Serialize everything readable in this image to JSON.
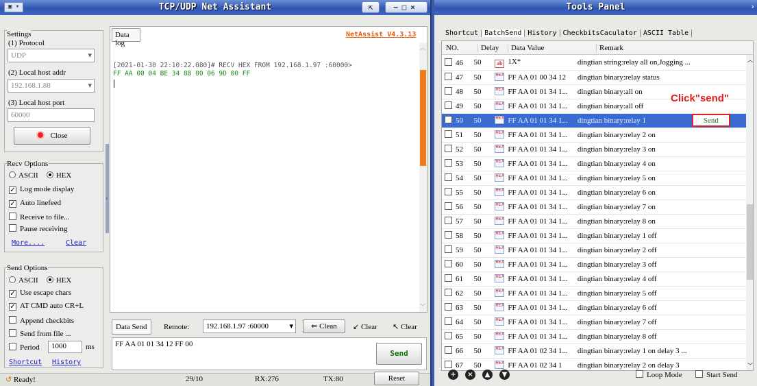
{
  "left_window": {
    "title": "TCP/UDP Net Assistant",
    "menu_icon": "app-menu-icon",
    "pin_icon": "pin-icon",
    "min_icon": "minimize-icon",
    "max_icon": "maximize-icon",
    "close_icon": "close-icon"
  },
  "settings": {
    "group_label": "Settings",
    "protocol_label": "(1) Protocol",
    "protocol_value": "UDP",
    "host_addr_label": "(2) Local host addr",
    "host_addr_value": "192.168.1.88",
    "port_label": "(3) Local host port",
    "port_value": "60000",
    "close_button": "Close"
  },
  "recv_options": {
    "label": "Recv Options",
    "ascii": "ASCII",
    "hex": "HEX",
    "log_mode": "Log mode display",
    "auto_linefeed": "Auto linefeed",
    "receive_file": "Receive to file...",
    "pause": "Pause receiving",
    "more_link": "More....",
    "clear_link": "Clear"
  },
  "send_options": {
    "label": "Send Options",
    "ascii": "ASCII",
    "hex": "HEX",
    "escape": "Use escape chars",
    "at_cmd": "AT CMD auto CR+L",
    "append_check": "Append checkbits",
    "send_file": "Send from file ...",
    "period": "Period",
    "period_value": "1000",
    "period_unit": "ms",
    "shortcut_link": "Shortcut",
    "history_link": "History"
  },
  "data_log": {
    "tab": "Data log",
    "version": "NetAssist V4.3.13",
    "line1": "[2021-01-30 22:10:22.080]# RECV HEX FROM 192.168.1.97 :60000>",
    "line2": "FF AA 00 04 BE 34 88 00 06 9D 00 FF"
  },
  "data_send": {
    "tab": "Data Send",
    "remote_label": "Remote:",
    "remote_value": "192.168.1.97 :60000",
    "clean_btn": "Clean",
    "clear_btn1": "Clear",
    "clear_btn2": "Clear",
    "text": "FF AA 01 01 34 12 FF 00",
    "send_button": "Send"
  },
  "status": {
    "ready": "Ready!",
    "ratio": "29/10",
    "rx": "RX:276",
    "tx": "TX:80",
    "reset": "Reset"
  },
  "tools": {
    "title": "Tools Panel",
    "tabs": [
      "Shortcut",
      "BatchSend",
      "History",
      "CheckbitsCaculator",
      "ASCII Table"
    ],
    "columns": [
      "NO.",
      "Delay",
      "Data Value",
      "Remark"
    ],
    "rows": [
      {
        "no": "46",
        "delay": "50",
        "type": "ab",
        "value": "1X*",
        "remark": "dingtian string:relay all on,Jogging ..."
      },
      {
        "no": "47",
        "delay": "50",
        "type": "hex",
        "value": "FF AA 01 00 34 12",
        "remark": "dingtian binary:relay status"
      },
      {
        "no": "48",
        "delay": "50",
        "type": "hex",
        "value": "FF AA 01 01 34 1...",
        "remark": "dingtian binary:all on"
      },
      {
        "no": "49",
        "delay": "50",
        "type": "hex",
        "value": "FF AA 01 01 34 1...",
        "remark": "dingtian binary:all off"
      },
      {
        "no": "50",
        "delay": "50",
        "type": "hex",
        "value": "FF AA 01 01 34 1...",
        "remark": "dingtian binary:relay 1",
        "selected": true
      },
      {
        "no": "51",
        "delay": "50",
        "type": "hex",
        "value": "FF AA 01 01 34 1...",
        "remark": "dingtian binary:relay 2 on"
      },
      {
        "no": "52",
        "delay": "50",
        "type": "hex",
        "value": "FF AA 01 01 34 1...",
        "remark": "dingtian binary:relay 3 on"
      },
      {
        "no": "53",
        "delay": "50",
        "type": "hex",
        "value": "FF AA 01 01 34 1...",
        "remark": "dingtian binary:relay 4 on"
      },
      {
        "no": "54",
        "delay": "50",
        "type": "hex",
        "value": "FF AA 01 01 34 1...",
        "remark": "dingtian binary:relay 5 on"
      },
      {
        "no": "55",
        "delay": "50",
        "type": "hex",
        "value": "FF AA 01 01 34 1...",
        "remark": "dingtian binary:relay 6 on"
      },
      {
        "no": "56",
        "delay": "50",
        "type": "hex",
        "value": "FF AA 01 01 34 1...",
        "remark": "dingtian binary:relay 7 on"
      },
      {
        "no": "57",
        "delay": "50",
        "type": "hex",
        "value": "FF AA 01 01 34 1...",
        "remark": "dingtian binary:relay 8 on"
      },
      {
        "no": "58",
        "delay": "50",
        "type": "hex",
        "value": "FF AA 01 01 34 1...",
        "remark": "dingtian binary:relay 1 off"
      },
      {
        "no": "59",
        "delay": "50",
        "type": "hex",
        "value": "FF AA 01 01 34 1...",
        "remark": "dingtian binary:relay 2 off"
      },
      {
        "no": "60",
        "delay": "50",
        "type": "hex",
        "value": "FF AA 01 01 34 1...",
        "remark": "dingtian binary:relay 3 off"
      },
      {
        "no": "61",
        "delay": "50",
        "type": "hex",
        "value": "FF AA 01 01 34 1...",
        "remark": "dingtian binary:relay 4 off"
      },
      {
        "no": "62",
        "delay": "50",
        "type": "hex",
        "value": "FF AA 01 01 34 1...",
        "remark": "dingtian binary:relay 5 off"
      },
      {
        "no": "63",
        "delay": "50",
        "type": "hex",
        "value": "FF AA 01 01 34 1...",
        "remark": "dingtian binary:relay 6 off"
      },
      {
        "no": "64",
        "delay": "50",
        "type": "hex",
        "value": "FF AA 01 01 34 1...",
        "remark": "dingtian binary:relay 7 off"
      },
      {
        "no": "65",
        "delay": "50",
        "type": "hex",
        "value": "FF AA 01 01 34 1...",
        "remark": "dingtian binary:relay 8 off"
      },
      {
        "no": "66",
        "delay": "50",
        "type": "hex",
        "value": "FF AA 01 02 34 1...",
        "remark": "dingtian binary:relay 1 on delay 3 ..."
      },
      {
        "no": "67",
        "delay": "50",
        "type": "hex",
        "value": "FF AA 01 02 34 1",
        "remark": "dingtian binary:relay 2 on delay 3"
      }
    ],
    "row_send_button": "Send",
    "annotation": "Click\"send\"",
    "loop_mode": "Loop Mode",
    "start_send": "Start Send",
    "hex_badge": "HEX",
    "ab_badge": "ab"
  },
  "colors": {
    "accent": "#3a6bd1",
    "annotation": "#e02020",
    "log_text": "#1a8a1a",
    "send_button": "#0a7a0a"
  }
}
